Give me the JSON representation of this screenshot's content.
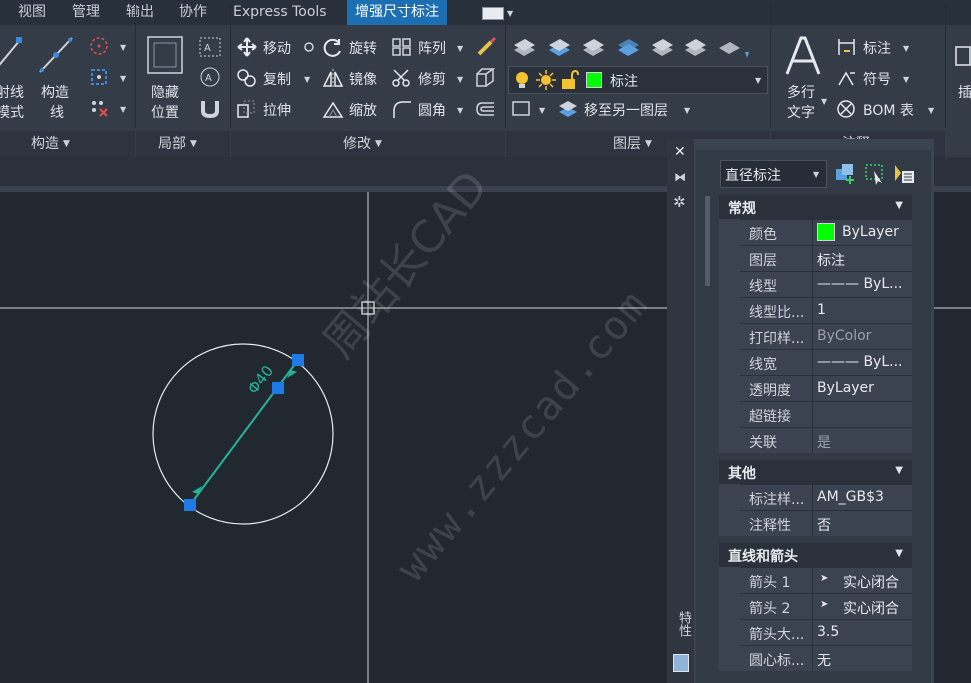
{
  "menu": {
    "tabs": [
      "视图",
      "管理",
      "输出",
      "协作",
      "Express Tools",
      "增强尺寸标注"
    ],
    "active_tab": "增强尺寸标注"
  },
  "ribbon": {
    "construct": {
      "line_left_a": "射线",
      "line_left_b": "模式",
      "construct_line_a": "构造",
      "construct_line_b": "线",
      "group_title": "构造"
    },
    "local": {
      "hide_a": "隐藏",
      "hide_b": "位置",
      "group_title": "局部"
    },
    "modify": {
      "move": "移动",
      "rotate": "旋转",
      "array": "阵列",
      "copy": "复制",
      "mirror": "镜像",
      "trim": "修剪",
      "stretch": "拉伸",
      "scale": "缩放",
      "fillet": "圆角",
      "group_title": "修改"
    },
    "layers": {
      "current_layer": "标注",
      "move_to_layer": "移至另一图层",
      "group_title": "图层",
      "layer_color": "#00ff00"
    },
    "annotation": {
      "mtext_a": "多行",
      "mtext_b": "文字",
      "dimension": "标注",
      "symbol": "符号",
      "bom": "BOM 表",
      "group_title_partial": "注释",
      "insert_partial": "插"
    }
  },
  "drawing": {
    "dimension_text": "Φ40",
    "watermark_cn": "周站长CAD",
    "watermark_url": "www.zzzcad.com"
  },
  "properties": {
    "object_type": "直径标注",
    "side_label": "特性",
    "sections": [
      {
        "title": "常规",
        "rows": [
          {
            "k": "颜色",
            "v": "ByLayer",
            "swatch": "#00ff00"
          },
          {
            "k": "图层",
            "v": "标注"
          },
          {
            "k": "线型",
            "v": "——— ByL..."
          },
          {
            "k": "线型比...",
            "v": "1"
          },
          {
            "k": "打印样...",
            "v": "ByColor",
            "grey": true
          },
          {
            "k": "线宽",
            "v": "——— ByL..."
          },
          {
            "k": "透明度",
            "v": "ByLayer"
          },
          {
            "k": "超链接",
            "v": ""
          },
          {
            "k": "关联",
            "v": "是",
            "grey": true
          }
        ]
      },
      {
        "title": "其他",
        "rows": [
          {
            "k": "标注样...",
            "v": "AM_GB$3"
          },
          {
            "k": "注释性",
            "v": "否"
          }
        ]
      },
      {
        "title": "直线和箭头",
        "rows": [
          {
            "k": "箭头 1",
            "v": "实心闭合",
            "arrow": true
          },
          {
            "k": "箭头 2",
            "v": "实心闭合",
            "arrow": true
          },
          {
            "k": "箭头大...",
            "v": "3.5"
          },
          {
            "k": "圆心标...",
            "v": "无"
          }
        ]
      }
    ]
  }
}
